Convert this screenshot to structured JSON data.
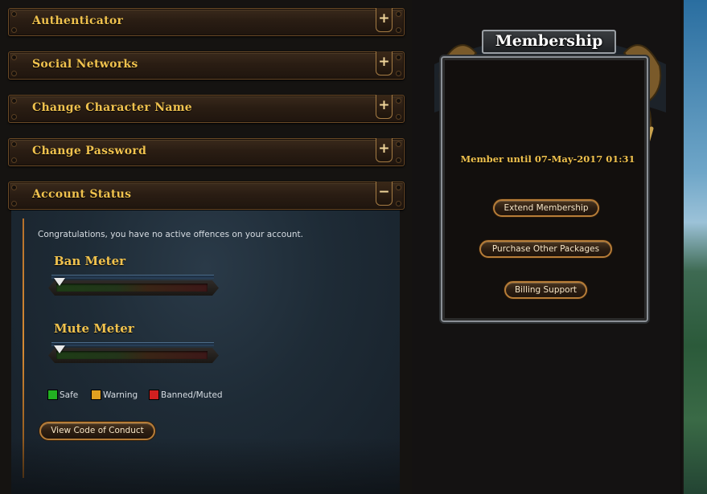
{
  "accordion": [
    {
      "title": "Authenticator",
      "toggle": "+"
    },
    {
      "title": "Social Networks",
      "toggle": "+"
    },
    {
      "title": "Change Character Name",
      "toggle": "+"
    },
    {
      "title": "Change Password",
      "toggle": "+"
    },
    {
      "title": "Account Status",
      "toggle": "−"
    }
  ],
  "account_status": {
    "message": "Congratulations, you have no active offences on your account.",
    "ban_meter": {
      "title": "Ban Meter",
      "level": 0
    },
    "mute_meter": {
      "title": "Mute Meter",
      "level": 0
    },
    "legend": [
      {
        "label": "Safe",
        "color": "#22b022"
      },
      {
        "label": "Warning",
        "color": "#e0a020"
      },
      {
        "label": "Banned/Muted",
        "color": "#d02020"
      }
    ],
    "code_of_conduct_button": "View Code of Conduct"
  },
  "membership": {
    "title": "Membership",
    "member_until": "Member until 07-May-2017 01:31",
    "buttons": {
      "extend": "Extend Membership",
      "purchase": "Purchase Other Packages",
      "billing": "Billing Support"
    }
  },
  "colors": {
    "accent_gold": "#f0c24e",
    "button_border": "#b77d38"
  }
}
